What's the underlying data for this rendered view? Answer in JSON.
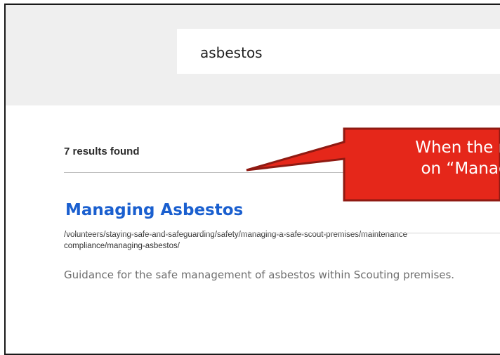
{
  "search": {
    "query": "asbestos"
  },
  "results": {
    "count_label": "7 results found",
    "items": [
      {
        "title": "Managing Asbestos",
        "url_line1": "/volunteers/staying-safe-and-safeguarding/safety/managing-a-safe-scout-premises/maintenance",
        "url_line2": "compliance/managing-asbestos/",
        "description": "Guidance for the safe management of asbestos within Scouting premises."
      }
    ]
  },
  "callout": {
    "line1": "When the re",
    "line2": "on “Manag",
    "fill_color": "#e5271a",
    "border_color": "#8f1a12"
  }
}
